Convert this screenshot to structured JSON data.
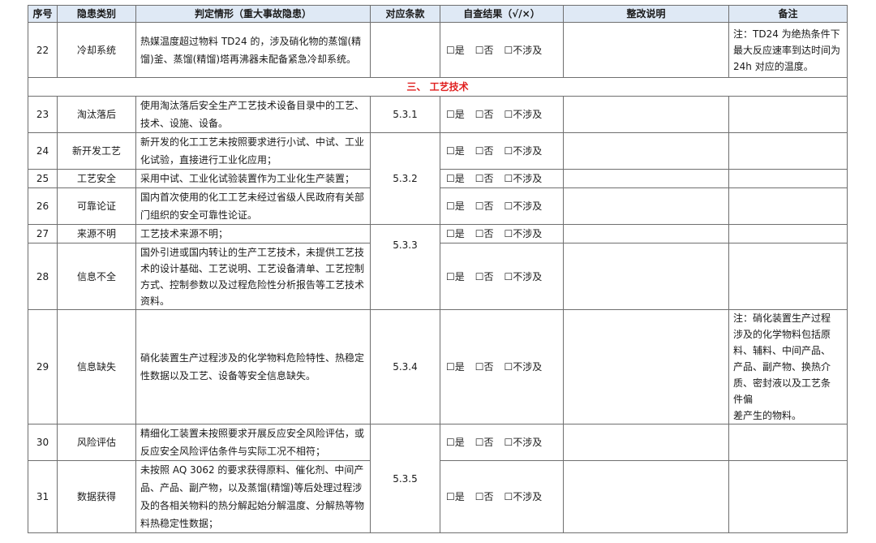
{
  "header": {
    "no": "序号",
    "category": "隐患类别",
    "situation": "判定情形（重大事故隐患）",
    "clause": "对应条款",
    "result": "自查结果（√/×）",
    "rectification": "整改说明",
    "remark": "备注"
  },
  "options": {
    "yes": "☐是",
    "no": "☐否",
    "na": "☐不涉及"
  },
  "section_title": "三、  工艺技术",
  "rows": [
    {
      "no": "22",
      "category": "冷却系统",
      "situation": "热媒温度超过物料 TD24 的，涉及硝化物的蒸馏(精馏)釜、蒸馏(精馏)塔再沸器未配备紧急冷却系统。",
      "remark": "注：TD24 为绝热条件下最大反应速率到达时间为 24h 对应的温度。"
    },
    {
      "no": "23",
      "category": "淘汰落后",
      "situation": "使用淘汰落后安全生产工艺技术设备目录中的工艺、技术、设施、设备。",
      "clause": "5.3.1"
    },
    {
      "no": "24",
      "category": "新开发工艺",
      "situation": "新开发的化工工艺未按照要求进行小试、中试、工业化试验，直接进行工业化应用；"
    },
    {
      "no": "25",
      "category": "工艺安全",
      "situation": "采用中试、工业化试验装置作为工业化生产装置；",
      "clause": "5.3.2"
    },
    {
      "no": "26",
      "category": "可靠论证",
      "situation": "国内首次使用的化工工艺未经过省级人民政府有关部门组织的安全可靠性论证。"
    },
    {
      "no": "27",
      "category": "来源不明",
      "situation": "工艺技术来源不明；"
    },
    {
      "no": "28",
      "category": "信息不全",
      "situation": "国外引进或国内转让的生产工艺技术，未提供工艺技术的设计基础、工艺说明、工艺设备清单、工艺控制方式、控制参数以及过程危险性分析报告等工艺技术资料。",
      "clause": "5.3.3"
    },
    {
      "no": "29",
      "category": "信息缺失",
      "situation": "硝化装置生产过程涉及的化学物料危险特性、热稳定性数据以及工艺、设备等安全信息缺失。",
      "clause": "5.3.4",
      "remark_lines": [
        "注：硝化装置生产过程",
        "涉及的化学物料包括原",
        "料、辅料、中间产品、",
        "产品、副产物、换热介",
        "质、密封液以及工艺条",
        "件偏",
        "差产生的物料。"
      ]
    },
    {
      "no": "30",
      "category": "风险评估",
      "situation": "精细化工装置未按照要求开展反应安全风险评估，或反应安全风险评估条件与实际工况不相符；"
    },
    {
      "no": "31",
      "category": "数据获得",
      "situation": "未按照 AQ 3062 的要求获得原料、催化剂、中间产品、产品、副产物，以及蒸馏(精馏)等后处理过程涉及的各相关物料的热分解起始分解温度、分解热等物料热稳定性数据；",
      "clause": "5.3.5"
    }
  ]
}
